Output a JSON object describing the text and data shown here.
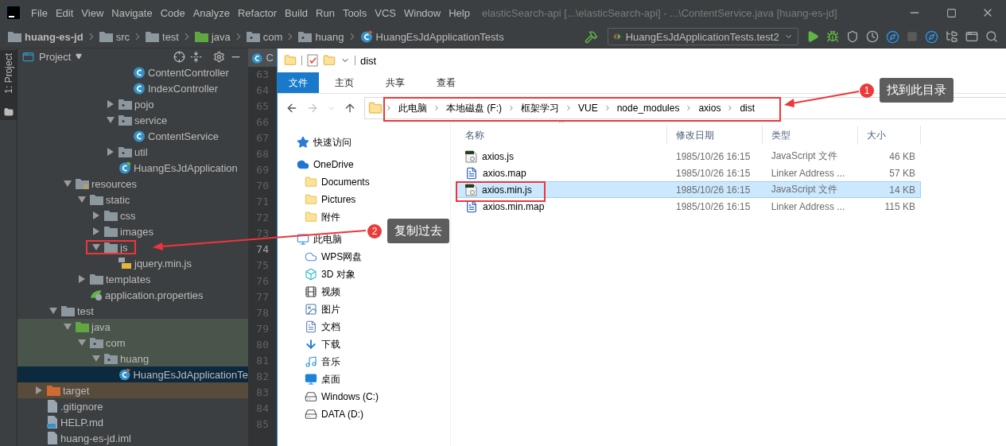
{
  "ide": {
    "menus": [
      "File",
      "Edit",
      "View",
      "Navigate",
      "Code",
      "Analyze",
      "Refactor",
      "Build",
      "Run",
      "Tools",
      "VCS",
      "Window",
      "Help"
    ],
    "title": "elasticSearch-api [...\\elasticSearch-api] - ...\\ContentService.java [huang-es-jd]",
    "breadcrumbs": [
      {
        "label": "huang-es-jd",
        "kind": "module"
      },
      {
        "label": "src",
        "kind": "folder"
      },
      {
        "label": "test",
        "kind": "folder"
      },
      {
        "label": "java",
        "kind": "test-root"
      },
      {
        "label": "com",
        "kind": "package"
      },
      {
        "label": "huang",
        "kind": "package"
      },
      {
        "label": "HuangEsJdApplicationTests",
        "kind": "test-class"
      }
    ],
    "run_config": "HuangEsJdApplicationTests.test2",
    "tool_window_tab": "1: Project",
    "project_panel": {
      "title": "Project",
      "tree": [
        {
          "children": [
            {
              "children": [
                {
                  "children": [
                    {
                      "children": [
                        {
                          "children": [
                            {
                              "children": [
                                {
                                  "label": "ContentController",
                                  "kind": "class",
                                  "selected": false
                                },
                                {
                                  "label": "IndexController",
                                  "kind": "class",
                                  "selected": false
                                }
                              ]
                            },
                            {
                              "label": "pojo",
                              "kind": "package",
                              "expanded": false,
                              "selected": false
                            },
                            {
                              "label": "service",
                              "kind": "package",
                              "expanded": true,
                              "selected": false,
                              "children": [
                                {
                                  "label": "ContentService",
                                  "kind": "class",
                                  "selected": false
                                }
                              ]
                            },
                            {
                              "label": "util",
                              "kind": "package",
                              "expanded": false,
                              "selected": false
                            },
                            {
                              "label": "HuangEsJdApplication",
                              "kind": "spring-class",
                              "selected": false
                            }
                          ]
                        }
                      ]
                    }
                  ]
                },
                {
                  "label": "resources",
                  "kind": "resources-root",
                  "expanded": true,
                  "selected": false,
                  "children": [
                    {
                      "label": "static",
                      "kind": "folder",
                      "expanded": true,
                      "selected": false,
                      "children": [
                        {
                          "label": "css",
                          "kind": "folder",
                          "expanded": false,
                          "selected": false
                        },
                        {
                          "label": "images",
                          "kind": "folder",
                          "expanded": false,
                          "selected": false
                        },
                        {
                          "label": "js",
                          "kind": "folder",
                          "expanded": true,
                          "selected": false,
                          "children": [
                            {
                              "label": "jquery.min.js",
                              "kind": "js-file",
                              "selected": false
                            }
                          ]
                        }
                      ]
                    },
                    {
                      "label": "templates",
                      "kind": "folder",
                      "expanded": false,
                      "selected": false
                    },
                    {
                      "label": "application.properties",
                      "kind": "properties",
                      "selected": false
                    }
                  ]
                }
              ]
            },
            {
              "label": "test",
              "kind": "folder",
              "expanded": true,
              "selected": false,
              "children": [
                {
                  "label": "java",
                  "kind": "test-root",
                  "expanded": true,
                  "selected": false,
                  "test_source": true,
                  "children": [
                    {
                      "label": "com",
                      "kind": "package",
                      "expanded": true,
                      "selected": false,
                      "test_source": true,
                      "children": [
                        {
                          "label": "huang",
                          "kind": "package",
                          "expanded": true,
                          "selected": false,
                          "test_source": true,
                          "children": [
                            {
                              "label": "HuangEsJdApplicationTe",
                              "kind": "test-class",
                              "selected": true
                            }
                          ]
                        }
                      ]
                    }
                  ]
                }
              ]
            }
          ]
        },
        {
          "label": "target",
          "kind": "excluded-folder",
          "expanded": false,
          "selected": false,
          "excluded": true
        },
        {
          "label": ".gitignore",
          "kind": "ignore-file",
          "selected": false
        },
        {
          "label": "HELP.md",
          "kind": "md-file",
          "selected": false
        },
        {
          "label": "huang-es-jd.iml",
          "kind": "iml-file",
          "selected": false
        }
      ]
    },
    "editor_tab": "C",
    "line_numbers": [
      {
        "number": "63",
        "current": false
      },
      {
        "number": "64",
        "current": false
      },
      {
        "number": "65",
        "current": false
      },
      {
        "number": "66",
        "current": false
      },
      {
        "number": "67",
        "current": false
      },
      {
        "number": "68",
        "current": false
      },
      {
        "number": "69",
        "current": false
      },
      {
        "number": "70",
        "current": false
      },
      {
        "number": "71",
        "current": false
      },
      {
        "number": "72",
        "current": false
      },
      {
        "number": "73",
        "current": false
      },
      {
        "number": "74",
        "current": true
      },
      {
        "number": "75",
        "current": false
      },
      {
        "number": "76",
        "current": false
      },
      {
        "number": "77",
        "current": false
      },
      {
        "number": "78",
        "current": false
      },
      {
        "number": "79",
        "current": false
      },
      {
        "number": "80",
        "current": false
      },
      {
        "number": "81",
        "current": false
      },
      {
        "number": "82",
        "current": false
      },
      {
        "number": "83",
        "current": false
      },
      {
        "number": "84",
        "current": false
      },
      {
        "number": "85",
        "current": false
      }
    ]
  },
  "explorer": {
    "title": "dist",
    "ribbon_tabs": [
      {
        "label": "文件",
        "selected": true
      },
      {
        "label": "主页",
        "selected": false
      },
      {
        "label": "共享",
        "selected": false
      },
      {
        "label": "查看",
        "selected": false
      }
    ],
    "path": [
      "此电脑",
      "本地磁盘 (F:)",
      "框架学习",
      "VUE",
      "node_modules",
      "axios",
      "dist"
    ],
    "nav": [
      {
        "label": "快速访问",
        "kind": "quick-access"
      },
      {
        "label": "OneDrive",
        "kind": "onedrive",
        "children": [
          {
            "label": "Documents",
            "kind": "folder"
          },
          {
            "label": "Pictures",
            "kind": "folder"
          },
          {
            "label": "附件",
            "kind": "folder"
          }
        ]
      },
      {
        "label": "此电脑",
        "kind": "pc",
        "children": [
          {
            "label": "WPS网盘",
            "kind": "cloud"
          },
          {
            "label": "3D 对象",
            "kind": "objects"
          },
          {
            "label": "视频",
            "kind": "videos"
          },
          {
            "label": "图片",
            "kind": "pictures"
          },
          {
            "label": "文档",
            "kind": "documents"
          },
          {
            "label": "下载",
            "kind": "downloads"
          },
          {
            "label": "音乐",
            "kind": "music"
          },
          {
            "label": "桌面",
            "kind": "desktop"
          },
          {
            "label": "Windows (C:)",
            "kind": "drive"
          },
          {
            "label": "DATA (D:)",
            "kind": "drive"
          }
        ]
      }
    ],
    "columns": [
      "名称",
      "修改日期",
      "类型",
      "大小"
    ],
    "files": [
      {
        "name": "axios.js",
        "kind": "script",
        "modified": "1985/10/26 16:15",
        "type": "JavaScript 文件",
        "size": "46 KB",
        "selected": false
      },
      {
        "name": "axios.map",
        "kind": "text",
        "modified": "1985/10/26 16:15",
        "type": "Linker Address ...",
        "size": "57 KB",
        "selected": false
      },
      {
        "name": "axios.min.js",
        "kind": "script",
        "modified": "1985/10/26 16:15",
        "type": "JavaScript 文件",
        "size": "14 KB",
        "selected": true
      },
      {
        "name": "axios.min.map",
        "kind": "text",
        "modified": "1985/10/26 16:15",
        "type": "Linker Address ...",
        "size": "115 KB",
        "selected": false
      }
    ]
  },
  "annotations": [
    {
      "number": "1",
      "label": "找到此目录"
    },
    {
      "number": "2",
      "label": "复制过去"
    }
  ]
}
